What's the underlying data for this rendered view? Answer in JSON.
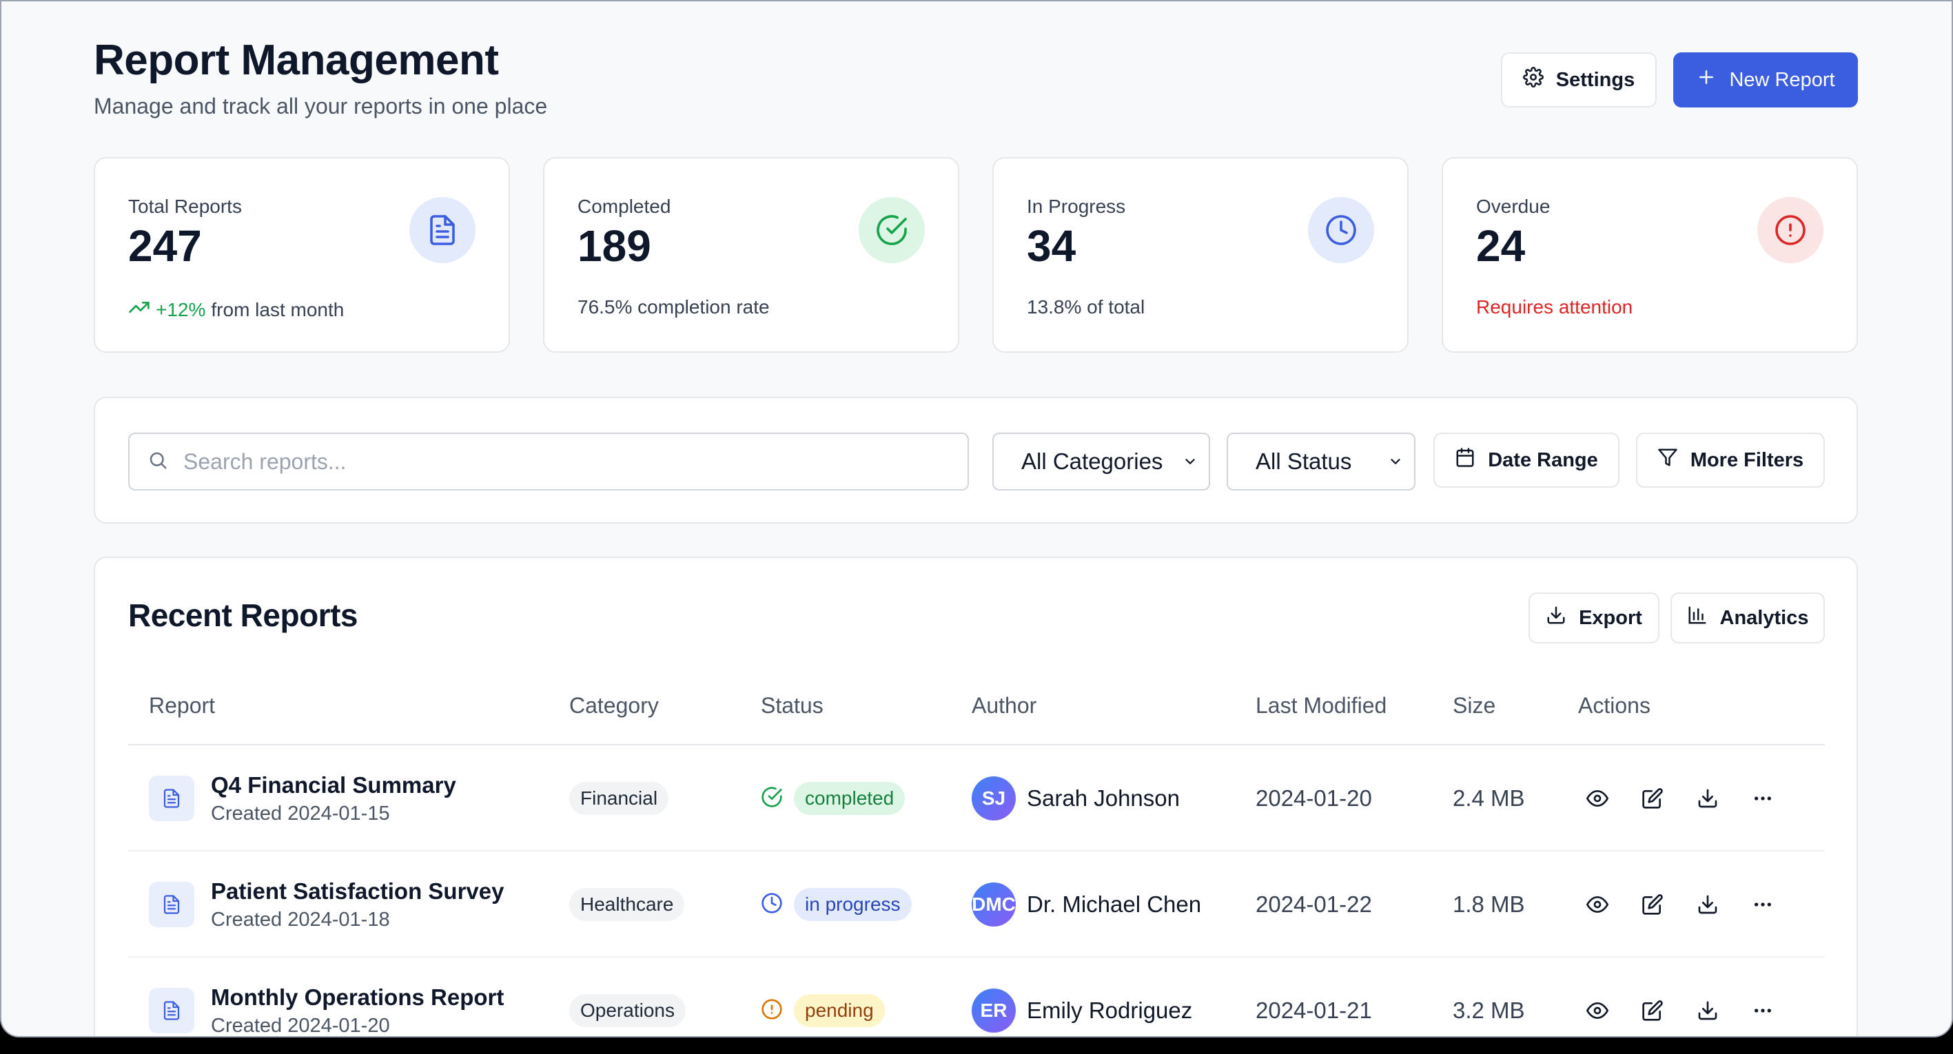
{
  "header": {
    "title": "Report Management",
    "subtitle": "Manage and track all your reports in one place",
    "settings_label": "Settings",
    "new_report_label": "New Report",
    "settings_icon": "gear-icon",
    "new_icon": "plus-icon"
  },
  "stats": [
    {
      "label": "Total Reports",
      "value": "247",
      "delta": "+12%",
      "note": "from last month",
      "icon": "document-icon",
      "color": "#3b5ee0"
    },
    {
      "label": "Completed",
      "value": "189",
      "note": "76.5% completion rate",
      "icon": "check-circle-icon",
      "color": "#16a34a"
    },
    {
      "label": "In Progress",
      "value": "34",
      "note": "13.8% of total",
      "icon": "clock-icon",
      "color": "#3b5ee0"
    },
    {
      "label": "Overdue",
      "value": "24",
      "note": "Requires attention",
      "icon": "alert-circle-icon",
      "color": "#dc2626"
    }
  ],
  "filters": {
    "search_placeholder": "Search reports...",
    "category_selected": "All Categories",
    "status_selected": "All Status",
    "date_range_label": "Date Range",
    "more_filters_label": "More Filters"
  },
  "table": {
    "title": "Recent Reports",
    "export_label": "Export",
    "analytics_label": "Analytics",
    "columns": [
      "Report",
      "Category",
      "Status",
      "Author",
      "Last Modified",
      "Size",
      "Actions"
    ],
    "rows": [
      {
        "name": "Q4 Financial Summary",
        "created": "Created 2024-01-15",
        "category": "Financial",
        "status": "completed",
        "status_color": "#16a34a",
        "author_initials": "SJ",
        "author": "Sarah Johnson",
        "modified": "2024-01-20",
        "size": "2.4 MB"
      },
      {
        "name": "Patient Satisfaction Survey",
        "created": "Created 2024-01-18",
        "category": "Healthcare",
        "status": "in progress",
        "status_color": "#3b5ee0",
        "author_initials": "DMC",
        "author": "Dr. Michael Chen",
        "modified": "2024-01-22",
        "size": "1.8 MB"
      },
      {
        "name": "Monthly Operations Report",
        "created": "Created 2024-01-20",
        "category": "Operations",
        "status": "pending",
        "status_color": "#d97706",
        "author_initials": "ER",
        "author": "Emily Rodriguez",
        "modified": "2024-01-21",
        "size": "3.2 MB"
      }
    ]
  }
}
